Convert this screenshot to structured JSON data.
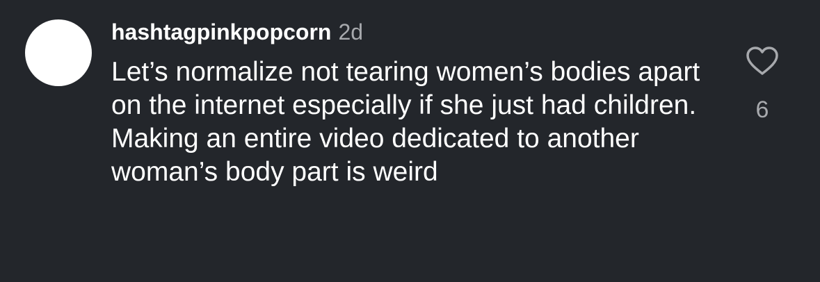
{
  "comment": {
    "username": "hashtagpinkpopcorn",
    "timestamp": "2d",
    "text": "Let’s normalize not tearing women’s bodies apart on the internet especially if she just had children. Making an entire video dedicated to another woman’s body part is weird",
    "like_count": "6",
    "like_icon": "heart-outline-icon"
  },
  "colors": {
    "background": "#23262b",
    "avatar": "#ffffff",
    "text": "#ffffff",
    "muted": "#a7a9ad"
  }
}
